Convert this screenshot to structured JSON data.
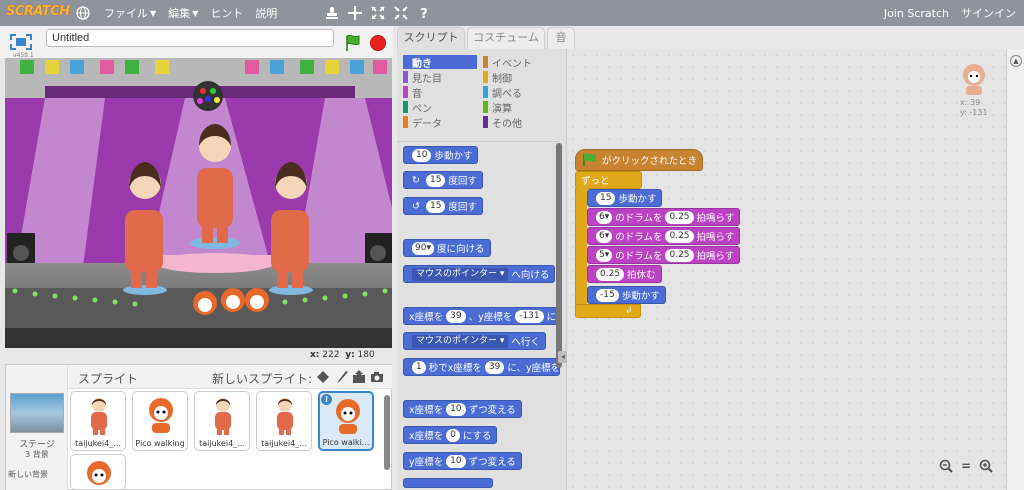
{
  "menubar": {
    "logo": "SCRATCH",
    "file": "ファイル",
    "edit": "編集",
    "hint": "ヒント",
    "about": "説明",
    "join": "Join Scratch",
    "signin": "サインイン"
  },
  "stage_header": {
    "title_value": "Untitled",
    "version": "v459.1"
  },
  "mouse": {
    "x_label": "x:",
    "x": "222",
    "y_label": "y:",
    "y": "180"
  },
  "sprites_panel": {
    "title": "スプライト",
    "new_sprite": "新しいスプライト:",
    "stage_label": "ステージ",
    "stage_bg_count": "3 背景",
    "new_bg": "新しい背景",
    "sprites": [
      {
        "name": "taijukei4_..."
      },
      {
        "name": "Pico walking"
      },
      {
        "name": "taijukei4_..."
      },
      {
        "name": "taijukei4_..."
      },
      {
        "name": "Pico walki..."
      }
    ]
  },
  "tabs": [
    "スクリプト",
    "コスチューム",
    "音"
  ],
  "categories": [
    {
      "label": "動き",
      "color": "#4a6cd4"
    },
    {
      "label": "イベント",
      "color": "#c88330"
    },
    {
      "label": "見た目",
      "color": "#8a55d7"
    },
    {
      "label": "制御",
      "color": "#e1a91a"
    },
    {
      "label": "音",
      "color": "#bb42c3"
    },
    {
      "label": "調べる",
      "color": "#2ca5e2"
    },
    {
      "label": "ペン",
      "color": "#0e9a6c"
    },
    {
      "label": "演算",
      "color": "#5cb712"
    },
    {
      "label": "データ",
      "color": "#ee7d16"
    },
    {
      "label": "その他",
      "color": "#632d99"
    }
  ],
  "palette_blocks": {
    "move": {
      "n": "10",
      "t": "歩動かす"
    },
    "turn_cw": {
      "n": "15",
      "t": "度回す"
    },
    "turn_ccw": {
      "n": "15",
      "t": "度回す"
    },
    "point_dir": {
      "n": "90",
      "t": "度に向ける"
    },
    "point_towards": {
      "dd": "マウスのポインター",
      "t": "へ向ける"
    },
    "goto_xy": {
      "a": "x座標を",
      "x": "39",
      "b": "、y座標を",
      "y": "-131",
      "c": "にする"
    },
    "goto": {
      "dd": "マウスのポインター",
      "t": "へ行く"
    },
    "glide": {
      "n": "1",
      "a": "秒でx座標を",
      "x": "39",
      "b": "に、y座標を"
    },
    "change_x": {
      "a": "x座標を",
      "n": "10",
      "b": "ずつ変える"
    },
    "set_x": {
      "a": "x座標を",
      "n": "0",
      "b": "にする"
    },
    "change_y": {
      "a": "y座標を",
      "n": "10",
      "b": "ずつ変える"
    }
  },
  "script": {
    "hat": "がクリックされたとき",
    "forever": "ずっと",
    "move1": {
      "n": "15",
      "t": "歩動かす"
    },
    "drum1": {
      "d": "6",
      "a": "のドラムを",
      "n": "0.25",
      "b": "拍鳴らす"
    },
    "drum2": {
      "d": "6",
      "a": "のドラムを",
      "n": "0.25",
      "b": "拍鳴らす"
    },
    "drum3": {
      "d": "5",
      "a": "のドラムを",
      "n": "0.25",
      "b": "拍鳴らす"
    },
    "rest": {
      "n": "0.25",
      "t": "拍休む"
    },
    "move2": {
      "n": "-15",
      "t": "歩動かす"
    }
  },
  "corner": {
    "x": "x: 39",
    "y": "y: -131"
  }
}
